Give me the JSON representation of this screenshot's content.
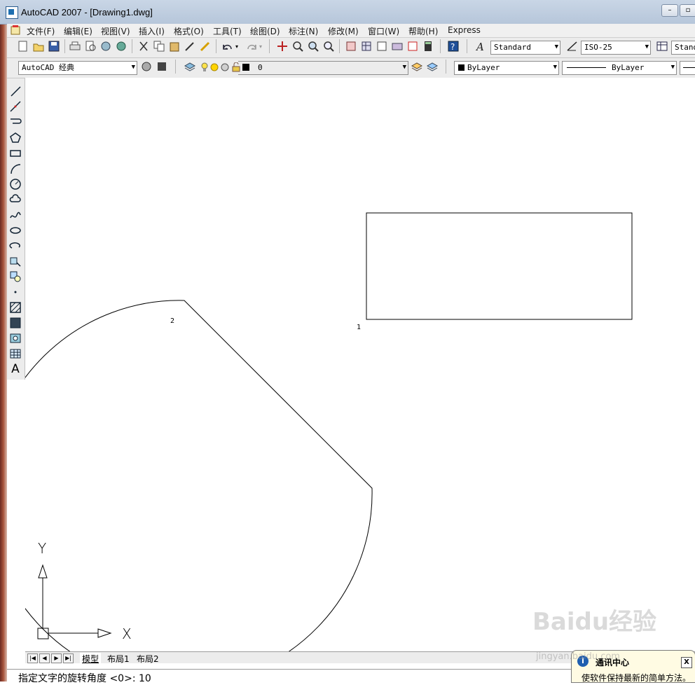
{
  "window": {
    "title": "AutoCAD 2007 - [Drawing1.dwg]",
    "minimize_label": "–",
    "restore_label": "▫"
  },
  "menu": {
    "items": [
      "文件(F)",
      "编辑(E)",
      "视图(V)",
      "插入(I)",
      "格式(O)",
      "工具(T)",
      "绘图(D)",
      "标注(N)",
      "修改(M)",
      "窗口(W)",
      "帮助(H)",
      "Express"
    ]
  },
  "toolbar1": {
    "text_style": "Standard",
    "dim_style": "ISO-25",
    "table_style": "Stand"
  },
  "toolbar2": {
    "workspace": "AutoCAD 经典",
    "layer": "0",
    "color": "ByLayer",
    "linetype": "ByLayer"
  },
  "left_toolbar": {
    "text_tool_label": "A"
  },
  "drawing": {
    "rect_label": "1",
    "sector_label": "2",
    "ucs_x": "X",
    "ucs_y": "Y"
  },
  "tabs": {
    "nav": [
      "|◀",
      "◀",
      "▶",
      "▶|"
    ],
    "items": [
      "模型",
      "布局1",
      "布局2"
    ]
  },
  "command": {
    "text": "指定文字的旋转角度 <0>: 10"
  },
  "notification": {
    "title": "通讯中心",
    "message": "使软件保持最新的简单方法。",
    "close_label": "X"
  },
  "watermark": {
    "brand": "Baidu经验",
    "url": "jingyan.baidu.com"
  }
}
